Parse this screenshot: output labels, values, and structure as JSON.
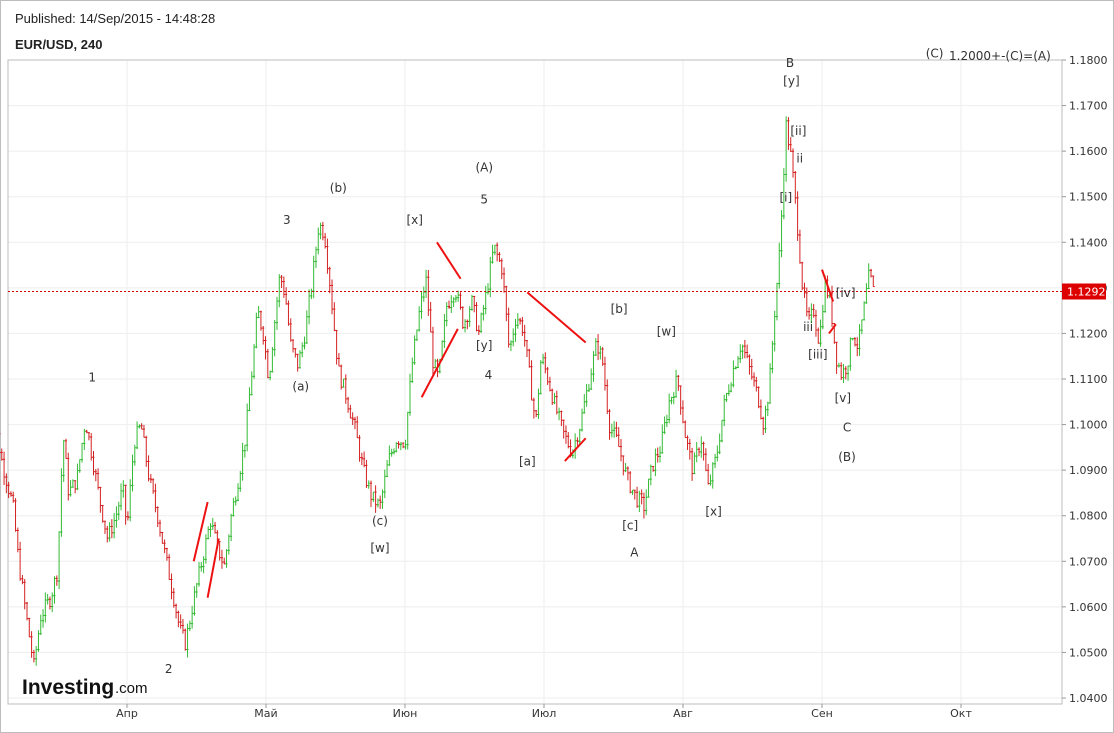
{
  "header": {
    "published": "Published: 14/Sep/2015 - 14:48:28",
    "symbol": "EUR/USD, 240"
  },
  "logo": {
    "main": "Investing",
    "suffix": ".com"
  },
  "colors": {
    "bull": "#33bb33",
    "bear": "#d42020",
    "trend": "#ee1111",
    "price_line": "#cc0000",
    "grid": "#eeeeee",
    "frame": "#bdbdbd"
  },
  "chart_data": {
    "type": "candlestick",
    "instrument": "EUR/USD",
    "timeframe": "240",
    "ylim": [
      1.04,
      1.18
    ],
    "yticks": [
      "1.0400",
      "1.0500",
      "1.0600",
      "1.0700",
      "1.0800",
      "1.0900",
      "1.1000",
      "1.1100",
      "1.1200",
      "1.1300",
      "1.1400",
      "1.1500",
      "1.1600",
      "1.1700",
      "1.1800"
    ],
    "xlim": [
      0,
      8.8
    ],
    "x_unit": "months starting at 1 March 2015",
    "xticks": [
      {
        "label": "Апр",
        "x": 1
      },
      {
        "label": "Май",
        "x": 2
      },
      {
        "label": "Июн",
        "x": 3
      },
      {
        "label": "Июл",
        "x": 4
      },
      {
        "label": "Авг",
        "x": 5
      },
      {
        "label": "Сен",
        "x": 6
      },
      {
        "label": "Окт",
        "x": 7
      }
    ],
    "current_price": {
      "label": "1.1292",
      "value": 1.1292
    },
    "price_path": [
      [
        0.0,
        1.112
      ],
      [
        0.05,
        1.1
      ],
      [
        0.1,
        1.092
      ],
      [
        0.18,
        1.082
      ],
      [
        0.22,
        1.07
      ],
      [
        0.28,
        1.057
      ],
      [
        0.33,
        1.047
      ],
      [
        0.38,
        1.058
      ],
      [
        0.45,
        1.062
      ],
      [
        0.5,
        1.068
      ],
      [
        0.54,
        1.098
      ],
      [
        0.58,
        1.085
      ],
      [
        0.64,
        1.088
      ],
      [
        0.7,
        1.101
      ],
      [
        0.75,
        1.093
      ],
      [
        0.8,
        1.084
      ],
      [
        0.86,
        1.075
      ],
      [
        0.92,
        1.08
      ],
      [
        0.97,
        1.086
      ],
      [
        1.0,
        1.077
      ],
      [
        1.05,
        1.096
      ],
      [
        1.1,
        1.1
      ],
      [
        1.16,
        1.088
      ],
      [
        1.22,
        1.08
      ],
      [
        1.27,
        1.072
      ],
      [
        1.33,
        1.063
      ],
      [
        1.38,
        1.055
      ],
      [
        1.42,
        1.052
      ],
      [
        1.47,
        1.06
      ],
      [
        1.51,
        1.066
      ],
      [
        1.56,
        1.073
      ],
      [
        1.6,
        1.079
      ],
      [
        1.65,
        1.073
      ],
      [
        1.7,
        1.069
      ],
      [
        1.75,
        1.08
      ],
      [
        1.8,
        1.088
      ],
      [
        1.85,
        1.097
      ],
      [
        1.9,
        1.112
      ],
      [
        1.94,
        1.125
      ],
      [
        1.98,
        1.12
      ],
      [
        2.02,
        1.11
      ],
      [
        2.06,
        1.122
      ],
      [
        2.1,
        1.133
      ],
      [
        2.14,
        1.128
      ],
      [
        2.18,
        1.117
      ],
      [
        2.23,
        1.113
      ],
      [
        2.28,
        1.12
      ],
      [
        2.33,
        1.131
      ],
      [
        2.38,
        1.144
      ],
      [
        2.42,
        1.142
      ],
      [
        2.46,
        1.131
      ],
      [
        2.52,
        1.112
      ],
      [
        2.58,
        1.106
      ],
      [
        2.64,
        1.099
      ],
      [
        2.7,
        1.09
      ],
      [
        2.76,
        1.084
      ],
      [
        2.82,
        1.082
      ],
      [
        2.88,
        1.092
      ],
      [
        2.94,
        1.097
      ],
      [
        3.0,
        1.096
      ],
      [
        3.05,
        1.113
      ],
      [
        3.1,
        1.124
      ],
      [
        3.15,
        1.132
      ],
      [
        3.2,
        1.114
      ],
      [
        3.24,
        1.11
      ],
      [
        3.3,
        1.126
      ],
      [
        3.36,
        1.13
      ],
      [
        3.42,
        1.122
      ],
      [
        3.48,
        1.127
      ],
      [
        3.53,
        1.12
      ],
      [
        3.58,
        1.128
      ],
      [
        3.64,
        1.139
      ],
      [
        3.7,
        1.134
      ],
      [
        3.75,
        1.116
      ],
      [
        3.8,
        1.124
      ],
      [
        3.85,
        1.121
      ],
      [
        3.89,
        1.112
      ],
      [
        3.94,
        1.1
      ],
      [
        3.98,
        1.115
      ],
      [
        4.02,
        1.111
      ],
      [
        4.08,
        1.104
      ],
      [
        4.14,
        1.098
      ],
      [
        4.2,
        1.094
      ],
      [
        4.26,
        1.1
      ],
      [
        4.32,
        1.109
      ],
      [
        4.38,
        1.118
      ],
      [
        4.42,
        1.114
      ],
      [
        4.47,
        1.1
      ],
      [
        4.53,
        1.096
      ],
      [
        4.6,
        1.088
      ],
      [
        4.66,
        1.084
      ],
      [
        4.72,
        1.082
      ],
      [
        4.78,
        1.091
      ],
      [
        4.84,
        1.095
      ],
      [
        4.9,
        1.105
      ],
      [
        4.96,
        1.11
      ],
      [
        5.02,
        1.097
      ],
      [
        5.07,
        1.09
      ],
      [
        5.13,
        1.097
      ],
      [
        5.18,
        1.086
      ],
      [
        5.24,
        1.093
      ],
      [
        5.3,
        1.105
      ],
      [
        5.36,
        1.112
      ],
      [
        5.42,
        1.118
      ],
      [
        5.48,
        1.112
      ],
      [
        5.54,
        1.106
      ],
      [
        5.58,
        1.1
      ],
      [
        5.62,
        1.108
      ],
      [
        5.66,
        1.125
      ],
      [
        5.7,
        1.14
      ],
      [
        5.74,
        1.166
      ],
      [
        5.78,
        1.158
      ],
      [
        5.82,
        1.145
      ],
      [
        5.86,
        1.13
      ],
      [
        5.9,
        1.122
      ],
      [
        5.94,
        1.125
      ],
      [
        5.98,
        1.118
      ],
      [
        6.02,
        1.131
      ],
      [
        6.06,
        1.127
      ],
      [
        6.1,
        1.115
      ],
      [
        6.14,
        1.111
      ],
      [
        6.18,
        1.113
      ],
      [
        6.22,
        1.12
      ],
      [
        6.26,
        1.117
      ],
      [
        6.3,
        1.125
      ],
      [
        6.34,
        1.133
      ],
      [
        6.37,
        1.1292
      ]
    ],
    "trend_lines": [
      [
        [
          1.48,
          1.07
        ],
        [
          1.58,
          1.083
        ]
      ],
      [
        [
          1.58,
          1.062
        ],
        [
          1.66,
          1.075
        ]
      ],
      [
        [
          3.12,
          1.106
        ],
        [
          3.38,
          1.121
        ]
      ],
      [
        [
          3.23,
          1.14
        ],
        [
          3.4,
          1.132
        ]
      ],
      [
        [
          3.88,
          1.129
        ],
        [
          4.3,
          1.118
        ]
      ],
      [
        [
          4.15,
          1.092
        ],
        [
          4.3,
          1.097
        ]
      ],
      [
        [
          6.0,
          1.134
        ],
        [
          6.08,
          1.127
        ]
      ],
      [
        [
          6.05,
          1.12
        ],
        [
          6.1,
          1.122
        ]
      ]
    ],
    "annotations": [
      {
        "text": "1",
        "x": 0.75,
        "y": 1.1095
      },
      {
        "text": "2",
        "x": 1.3,
        "y": 1.0455
      },
      {
        "text": "3",
        "x": 2.15,
        "y": 1.144
      },
      {
        "text": "(a)",
        "x": 2.25,
        "y": 1.1075
      },
      {
        "text": "(b)",
        "x": 2.52,
        "y": 1.151
      },
      {
        "text": "(c)",
        "x": 2.82,
        "y": 1.078
      },
      {
        "text": "[w]",
        "x": 2.82,
        "y": 1.072
      },
      {
        "text": "[x]",
        "x": 3.07,
        "y": 1.144
      },
      {
        "text": "(A)",
        "x": 3.57,
        "y": 1.1555
      },
      {
        "text": "5",
        "x": 3.57,
        "y": 1.1485
      },
      {
        "text": "[y]",
        "x": 3.57,
        "y": 1.1165
      },
      {
        "text": "4",
        "x": 3.6,
        "y": 1.11
      },
      {
        "text": "[a]",
        "x": 3.88,
        "y": 1.091
      },
      {
        "text": "[b]",
        "x": 4.54,
        "y": 1.1245
      },
      {
        "text": "[c]",
        "x": 4.62,
        "y": 1.077
      },
      {
        "text": "A",
        "x": 4.65,
        "y": 1.071
      },
      {
        "text": "[w]",
        "x": 4.88,
        "y": 1.1195
      },
      {
        "text": "[x]",
        "x": 5.22,
        "y": 1.08
      },
      {
        "text": "B",
        "x": 5.77,
        "y": 1.1785
      },
      {
        "text": "[y]",
        "x": 5.78,
        "y": 1.1745
      },
      {
        "text": "[ii]",
        "x": 5.83,
        "y": 1.1635
      },
      {
        "text": "ii",
        "x": 5.84,
        "y": 1.1575
      },
      {
        "text": "[i]",
        "x": 5.74,
        "y": 1.149
      },
      {
        "text": "[iv]",
        "x": 6.17,
        "y": 1.128
      },
      {
        "text": "iii",
        "x": 5.9,
        "y": 1.1205
      },
      {
        "text": "[iii]",
        "x": 5.97,
        "y": 1.1145
      },
      {
        "text": "[v]",
        "x": 6.15,
        "y": 1.105
      },
      {
        "text": "C",
        "x": 6.18,
        "y": 1.0985
      },
      {
        "text": "(B)",
        "x": 6.18,
        "y": 1.092
      },
      {
        "text": "(C)",
        "x": 6.81,
        "y": 1.1805
      },
      {
        "text": "1.2000+-(C)=(A)",
        "x": 7.28,
        "y": 1.18
      }
    ]
  }
}
